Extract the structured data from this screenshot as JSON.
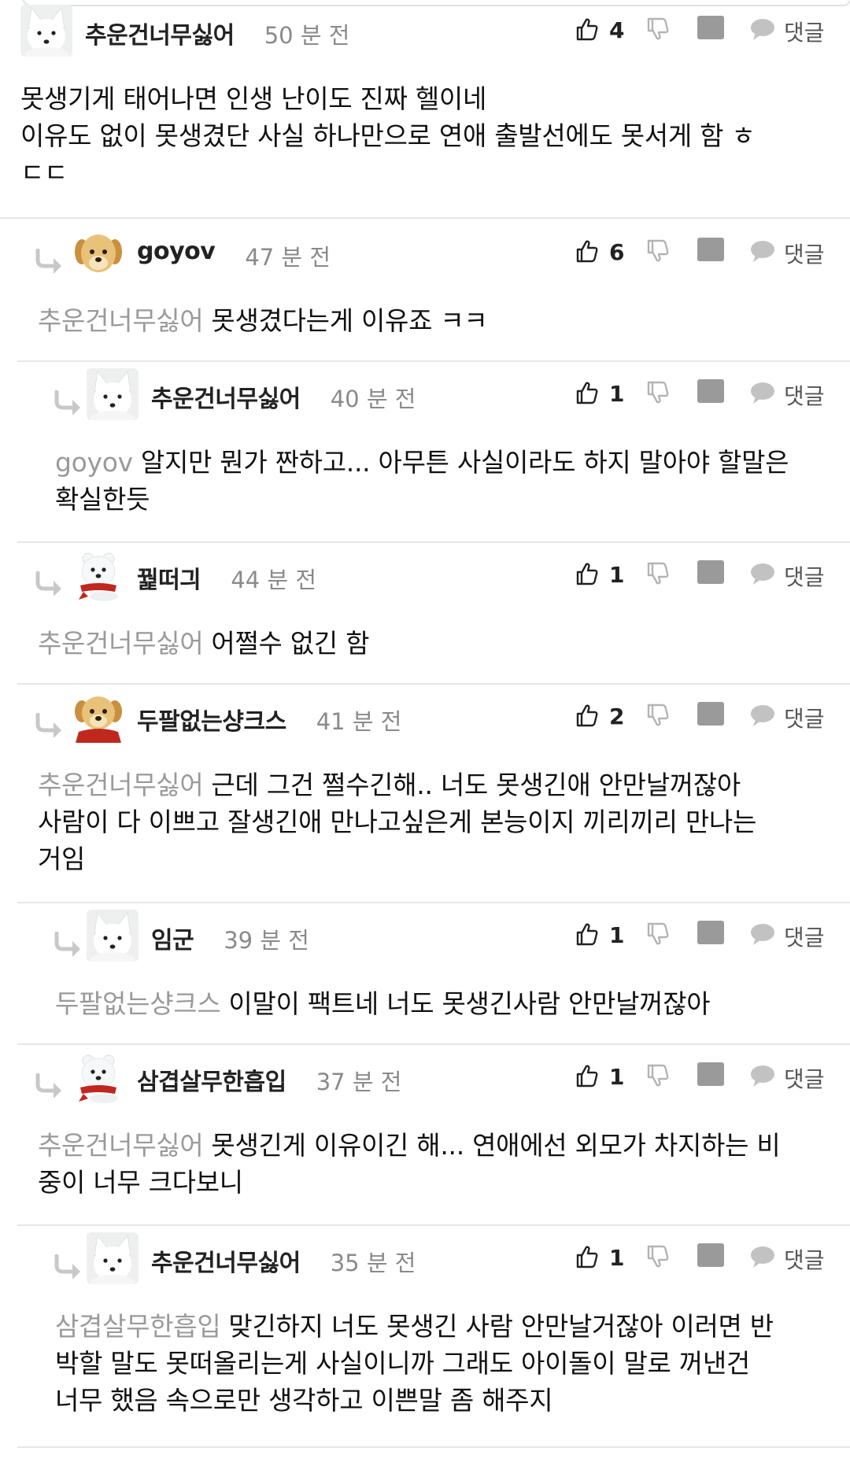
{
  "labels": {
    "reply": "댓글"
  },
  "icons": {
    "like": "thumbs-up-icon",
    "dislike": "thumbs-down-icon",
    "more": "more-dots-icon",
    "reply": "speech-bubble-icon",
    "reply_arrow": "reply-arrow-icon"
  },
  "comments": [
    {
      "author": "추운건너무싫어",
      "avatar": "white-fox-avatar",
      "time": "50 분 전",
      "likes": "4",
      "depth": 0,
      "mention": "",
      "lines": [
        "못생기게 태어나면 인생 난이도 진짜 헬이네",
        "이유도 없이 못생겼단 사실 하나만으로 연애 출발선에도 못서게 함 ㅎ",
        "ㄷㄷ"
      ]
    },
    {
      "author": "goyov",
      "avatar": "puppy-avatar",
      "time": "47 분 전",
      "likes": "6",
      "depth": 1,
      "mention": "추운건너무싫어",
      "lines": [
        "못생겼다는게 이유죠 ㅋㅋ"
      ]
    },
    {
      "author": "추운건너무싫어",
      "avatar": "white-fox-avatar",
      "time": "40 분 전",
      "likes": "1",
      "depth": 2,
      "mention": "goyov",
      "lines": [
        "알지만 뭔가 짠하고... 아무튼 사실이라도 하지 말아야 할말은",
        "확실한듯"
      ]
    },
    {
      "author": "꿡떠긔",
      "avatar": "polar-bear-scarf-avatar",
      "time": "44 분 전",
      "likes": "1",
      "depth": 1,
      "mention": "추운건너무싫어",
      "lines": [
        "어쩔수 없긴 함"
      ]
    },
    {
      "author": "두팔없는샹크스",
      "avatar": "puppy-scarf-avatar",
      "time": "41 분 전",
      "likes": "2",
      "depth": 1,
      "mention": "추운건너무싫어",
      "lines": [
        "근데 그건 쩔수긴해.. 너도 못생긴애 안만날꺼잖아",
        "사람이 다 이쁘고 잘생긴애 만나고싶은게 본능이지 끼리끼리 만나는",
        "거임"
      ]
    },
    {
      "author": "임군",
      "avatar": "white-fox-avatar",
      "time": "39 분 전",
      "likes": "1",
      "depth": 2,
      "mention": "두팔없는샹크스",
      "lines": [
        "이말이 팩트네 너도 못생긴사람 안만날꺼잖아"
      ]
    },
    {
      "author": "삼겹살무한흡입",
      "avatar": "polar-bear-scarf-avatar",
      "time": "37 분 전",
      "likes": "1",
      "depth": 1,
      "mention": "추운건너무싫어",
      "lines": [
        "못생긴게 이유이긴 해... 연애에선 외모가 차지하는 비",
        "중이 너무 크다보니"
      ]
    },
    {
      "author": "추운건너무싫어",
      "avatar": "white-fox-avatar",
      "time": "35 분 전",
      "likes": "1",
      "depth": 2,
      "mention": "삼겹살무한흡입",
      "lines": [
        "맞긴하지 너도 못생긴 사람 안만날거잖아 이러면 반",
        "박할 말도 못떠올리는게 사실이니까 그래도 아이돌이 말로 꺼낸건",
        "너무 했음 속으로만 생각하고 이쁜말 좀 해주지"
      ]
    }
  ]
}
